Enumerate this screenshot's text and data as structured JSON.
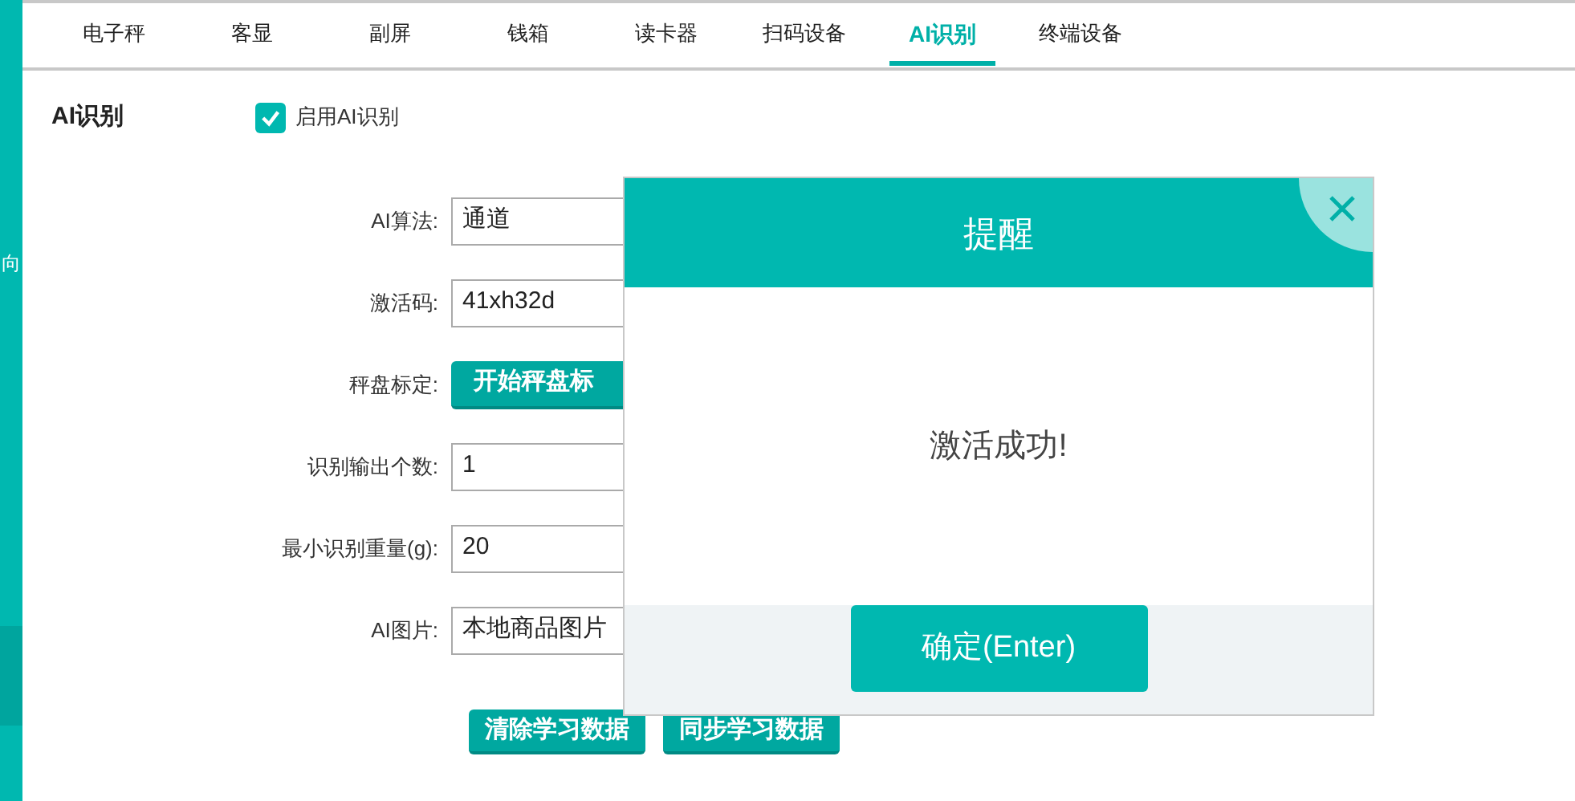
{
  "sidebar": {
    "label": "向"
  },
  "tabs": [
    {
      "label": "电子秤",
      "selected": false
    },
    {
      "label": "客显",
      "selected": false
    },
    {
      "label": "副屏",
      "selected": false
    },
    {
      "label": "钱箱",
      "selected": false
    },
    {
      "label": "读卡器",
      "selected": false
    },
    {
      "label": "扫码设备",
      "selected": false
    },
    {
      "label": "AI识别",
      "selected": true
    },
    {
      "label": "终端设备",
      "selected": false
    }
  ],
  "section": {
    "title": "AI识别",
    "enable_checkbox": {
      "label": "启用AI识别",
      "checked": true
    }
  },
  "form": [
    {
      "kind": "field",
      "label": "AI算法:",
      "value": "通道"
    },
    {
      "kind": "field",
      "label": "激活码:",
      "value": "41xh32d"
    },
    {
      "kind": "button",
      "label": "秤盘标定:",
      "value": "开始秤盘标"
    },
    {
      "kind": "field",
      "label": "识别输出个数:",
      "value": "1"
    },
    {
      "kind": "field",
      "label": "最小识别重量(g):",
      "value": "20"
    },
    {
      "kind": "field",
      "label": "AI图片:",
      "value": "本地商品图片"
    }
  ],
  "actions": [
    "清除学习数据",
    "同步学习数据"
  ],
  "dialog": {
    "title": "提醒",
    "message": "激活成功!",
    "button": "确定(Enter)"
  }
}
